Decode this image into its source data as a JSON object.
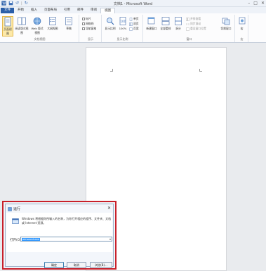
{
  "window": {
    "title": "文档1 - Microsoft Word"
  },
  "qat": {
    "undo": "↺",
    "redo": "↻",
    "separator": "|"
  },
  "window_controls": {
    "minimize": "–",
    "maximize": "□",
    "close": "✕"
  },
  "tabs": [
    {
      "label": "文件"
    },
    {
      "label": "开始"
    },
    {
      "label": "插入"
    },
    {
      "label": "页面布局"
    },
    {
      "label": "引用"
    },
    {
      "label": "邮件"
    },
    {
      "label": "审阅"
    },
    {
      "label": "视图"
    }
  ],
  "ribbon": {
    "views": {
      "label": "文档视图",
      "buttons": [
        "页面视图",
        "阅读版式视图",
        "Web 版式视图",
        "大纲视图",
        "草稿"
      ]
    },
    "show": {
      "label": "显示",
      "items": [
        "标尺",
        "网格线",
        "导航窗格"
      ]
    },
    "zoom": {
      "label": "显示比例",
      "buttons": [
        "显示比例",
        "100%"
      ],
      "small": [
        "单页",
        "双页",
        "页宽"
      ]
    },
    "window": {
      "label": "窗口",
      "buttons": [
        "新建窗口",
        "全部重排",
        "拆分"
      ],
      "small": [
        "并排查看",
        "同步滚动",
        "重设窗口位置"
      ],
      "switch": "切换窗口"
    },
    "macros": {
      "label": "宏",
      "button": "宏"
    }
  },
  "run_dialog": {
    "title": "运行",
    "close": "✕",
    "description": "Windows 将根据你所输入的名称，为你打开相应的程序、文件夹、文档或 Internet 资源。",
    "open_label": "打开(O):",
    "input_value": "winword.exe",
    "dropdown": "▾",
    "buttons": {
      "ok": "确定",
      "cancel": "取消",
      "browse": "浏览(B)..."
    }
  },
  "colors": {
    "file_tab": "#2a5ea8",
    "dialog_highlight": "#c8202a",
    "selected_view": "#fde9a8",
    "selection": "#3399ff"
  }
}
